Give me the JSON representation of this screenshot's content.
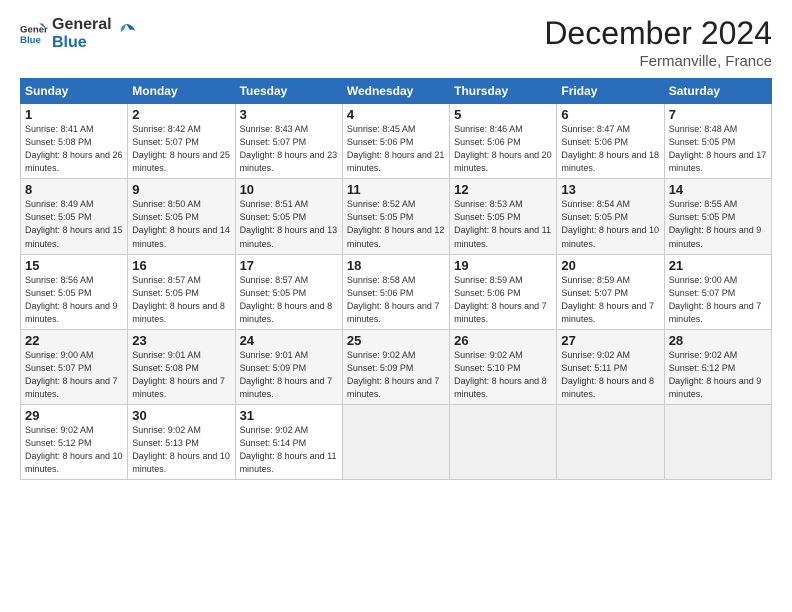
{
  "logo": {
    "line1": "General",
    "line2": "Blue"
  },
  "title": "December 2024",
  "subtitle": "Fermanville, France",
  "days_of_week": [
    "Sunday",
    "Monday",
    "Tuesday",
    "Wednesday",
    "Thursday",
    "Friday",
    "Saturday"
  ],
  "weeks": [
    [
      {
        "num": "1",
        "rise": "8:41 AM",
        "set": "5:08 PM",
        "hours": "8 hours and 26 minutes."
      },
      {
        "num": "2",
        "rise": "8:42 AM",
        "set": "5:07 PM",
        "hours": "8 hours and 25 minutes."
      },
      {
        "num": "3",
        "rise": "8:43 AM",
        "set": "5:07 PM",
        "hours": "8 hours and 23 minutes."
      },
      {
        "num": "4",
        "rise": "8:45 AM",
        "set": "5:06 PM",
        "hours": "8 hours and 21 minutes."
      },
      {
        "num": "5",
        "rise": "8:46 AM",
        "set": "5:06 PM",
        "hours": "8 hours and 20 minutes."
      },
      {
        "num": "6",
        "rise": "8:47 AM",
        "set": "5:06 PM",
        "hours": "8 hours and 18 minutes."
      },
      {
        "num": "7",
        "rise": "8:48 AM",
        "set": "5:05 PM",
        "hours": "8 hours and 17 minutes."
      }
    ],
    [
      {
        "num": "8",
        "rise": "8:49 AM",
        "set": "5:05 PM",
        "hours": "8 hours and 15 minutes."
      },
      {
        "num": "9",
        "rise": "8:50 AM",
        "set": "5:05 PM",
        "hours": "8 hours and 14 minutes."
      },
      {
        "num": "10",
        "rise": "8:51 AM",
        "set": "5:05 PM",
        "hours": "8 hours and 13 minutes."
      },
      {
        "num": "11",
        "rise": "8:52 AM",
        "set": "5:05 PM",
        "hours": "8 hours and 12 minutes."
      },
      {
        "num": "12",
        "rise": "8:53 AM",
        "set": "5:05 PM",
        "hours": "8 hours and 11 minutes."
      },
      {
        "num": "13",
        "rise": "8:54 AM",
        "set": "5:05 PM",
        "hours": "8 hours and 10 minutes."
      },
      {
        "num": "14",
        "rise": "8:55 AM",
        "set": "5:05 PM",
        "hours": "8 hours and 9 minutes."
      }
    ],
    [
      {
        "num": "15",
        "rise": "8:56 AM",
        "set": "5:05 PM",
        "hours": "8 hours and 9 minutes."
      },
      {
        "num": "16",
        "rise": "8:57 AM",
        "set": "5:05 PM",
        "hours": "8 hours and 8 minutes."
      },
      {
        "num": "17",
        "rise": "8:57 AM",
        "set": "5:05 PM",
        "hours": "8 hours and 8 minutes."
      },
      {
        "num": "18",
        "rise": "8:58 AM",
        "set": "5:06 PM",
        "hours": "8 hours and 7 minutes."
      },
      {
        "num": "19",
        "rise": "8:59 AM",
        "set": "5:06 PM",
        "hours": "8 hours and 7 minutes."
      },
      {
        "num": "20",
        "rise": "8:59 AM",
        "set": "5:07 PM",
        "hours": "8 hours and 7 minutes."
      },
      {
        "num": "21",
        "rise": "9:00 AM",
        "set": "5:07 PM",
        "hours": "8 hours and 7 minutes."
      }
    ],
    [
      {
        "num": "22",
        "rise": "9:00 AM",
        "set": "5:07 PM",
        "hours": "8 hours and 7 minutes."
      },
      {
        "num": "23",
        "rise": "9:01 AM",
        "set": "5:08 PM",
        "hours": "8 hours and 7 minutes."
      },
      {
        "num": "24",
        "rise": "9:01 AM",
        "set": "5:09 PM",
        "hours": "8 hours and 7 minutes."
      },
      {
        "num": "25",
        "rise": "9:02 AM",
        "set": "5:09 PM",
        "hours": "8 hours and 7 minutes."
      },
      {
        "num": "26",
        "rise": "9:02 AM",
        "set": "5:10 PM",
        "hours": "8 hours and 8 minutes."
      },
      {
        "num": "27",
        "rise": "9:02 AM",
        "set": "5:11 PM",
        "hours": "8 hours and 8 minutes."
      },
      {
        "num": "28",
        "rise": "9:02 AM",
        "set": "5:12 PM",
        "hours": "8 hours and 9 minutes."
      }
    ],
    [
      {
        "num": "29",
        "rise": "9:02 AM",
        "set": "5:12 PM",
        "hours": "8 hours and 10 minutes."
      },
      {
        "num": "30",
        "rise": "9:02 AM",
        "set": "5:13 PM",
        "hours": "8 hours and 10 minutes."
      },
      {
        "num": "31",
        "rise": "9:02 AM",
        "set": "5:14 PM",
        "hours": "8 hours and 11 minutes."
      },
      null,
      null,
      null,
      null
    ]
  ],
  "labels": {
    "sunrise": "Sunrise:",
    "sunset": "Sunset:",
    "daylight": "Daylight:"
  }
}
